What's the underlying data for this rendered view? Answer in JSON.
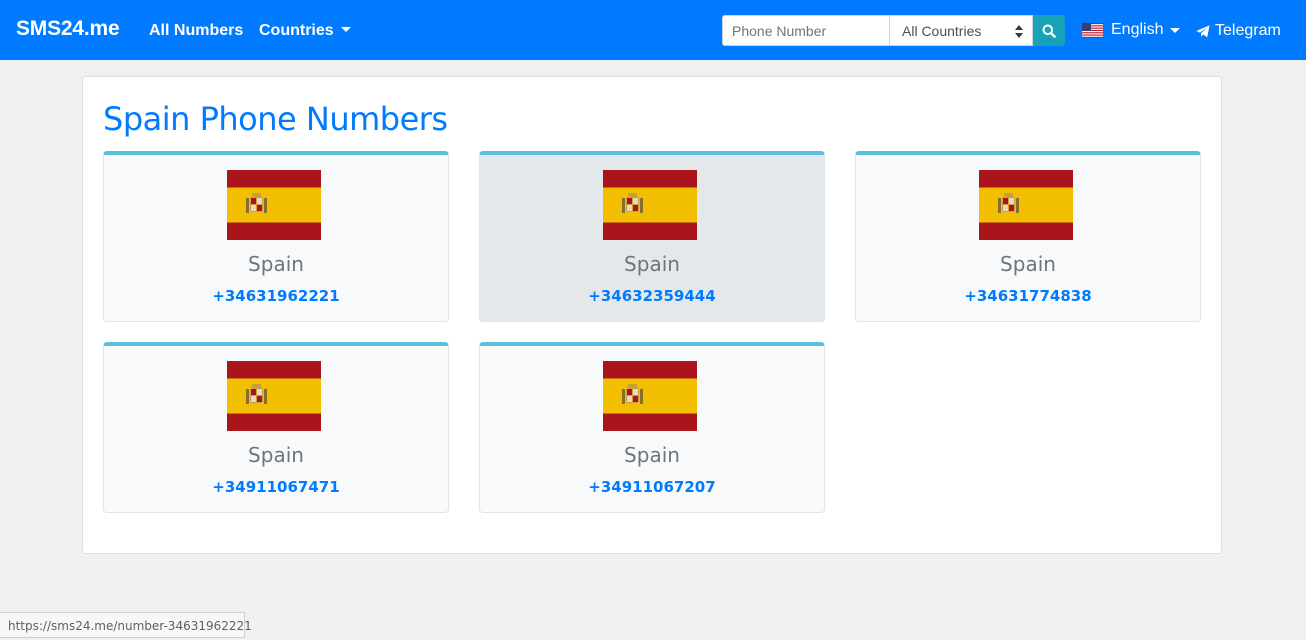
{
  "navbar": {
    "brand": "SMS24.me",
    "links": [
      "All Numbers",
      "Countries"
    ],
    "search": {
      "placeholder": "Phone Number",
      "country_selected": "All Countries"
    },
    "language": "English",
    "telegram": "Telegram",
    "colors": {
      "background": "#007bff",
      "search_button": "#17a2b8"
    }
  },
  "page": {
    "title": "Spain Phone Numbers"
  },
  "numbers": [
    {
      "country": "Spain",
      "phone": "+34631962221",
      "flag": "spain-flag-icon"
    },
    {
      "country": "Spain",
      "phone": "+34632359444",
      "flag": "spain-flag-icon"
    },
    {
      "country": "Spain",
      "phone": "+34631774838",
      "flag": "spain-flag-icon"
    },
    {
      "country": "Spain",
      "phone": "+34911067471",
      "flag": "spain-flag-icon"
    },
    {
      "country": "Spain",
      "phone": "+34911067207",
      "flag": "spain-flag-icon"
    }
  ],
  "status_bar": {
    "url": "https://sms24.me/number-34631962221"
  }
}
